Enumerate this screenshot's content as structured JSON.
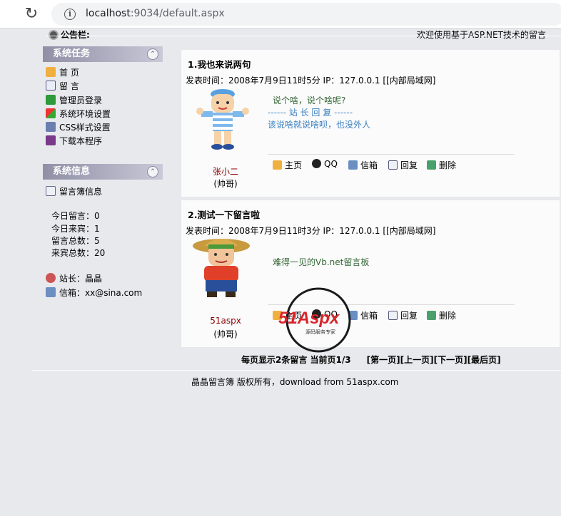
{
  "browser": {
    "url_host": "localhost",
    "url_rest": ":9034/default.aspx"
  },
  "header": {
    "notice_label": "公告栏:",
    "welcome": "欢迎使用基于ASP.NET技术的留言"
  },
  "sidebar": {
    "tasks_title": "系统任务",
    "tasks": [
      {
        "label": "首 页",
        "icon": "home-icon"
      },
      {
        "label": "留 言",
        "icon": "pencil-icon"
      },
      {
        "label": "管理员登录",
        "icon": "login-icon"
      },
      {
        "label": "系统环境设置",
        "icon": "windows-icon"
      },
      {
        "label": "CSS样式设置",
        "icon": "palette-icon"
      },
      {
        "label": "下载本程序",
        "icon": "download-icon"
      }
    ],
    "info_title": "系统信息",
    "info_link": "留言簿信息",
    "stats": [
      {
        "label": "今日留言：",
        "value": "0"
      },
      {
        "label": "今日来宾：",
        "value": "1"
      },
      {
        "label": "留言总数：",
        "value": "5"
      },
      {
        "label": "来宾总数：",
        "value": "20"
      }
    ],
    "admin_label": "站长：晶晶",
    "email_label": "信箱：xx@sina.com"
  },
  "posts": [
    {
      "title": "1.我也来说两句",
      "meta": "发表时间：2008年7月9日11时5分  IP：127.0.0.1 [[内部局域网]",
      "author": "张小二",
      "author_sub": "(帅哥)",
      "message": "说个啥，说个啥呢?",
      "reply_head": "------ 站 长 回 复 ------",
      "reply_body": "该说啥就说啥呗，也没外人"
    },
    {
      "title": "2.测试一下留言啦",
      "meta": "发表时间：2008年7月9日11时3分  IP：127.0.0.1 [[内部局域网]",
      "author": "51aspx",
      "author_sub": "(帅哥)",
      "message": "难得一见的Vb.net留言板",
      "reply_head": "",
      "reply_body": ""
    }
  ],
  "actions": {
    "home": "主页",
    "qq": "QQ",
    "mail": "信箱",
    "reply": "回复",
    "delete": "删除"
  },
  "pager": {
    "info": "每页显示2条留言 当前页1/3",
    "first": "[第一页]",
    "prev": "[上一页]",
    "next": "[下一页]",
    "last": "[最后页]"
  },
  "footer": "晶晶留言簿 版权所有，download from 51aspx.com",
  "watermark": {
    "brand": "51Aspx",
    "slogan": "源码服务专家"
  },
  "colors": {
    "page_bg": "#e8e9ed",
    "panel_bg": "#fbfbfc",
    "author": "#8b0000",
    "message": "#336633",
    "reply": "#3a7fbf"
  }
}
